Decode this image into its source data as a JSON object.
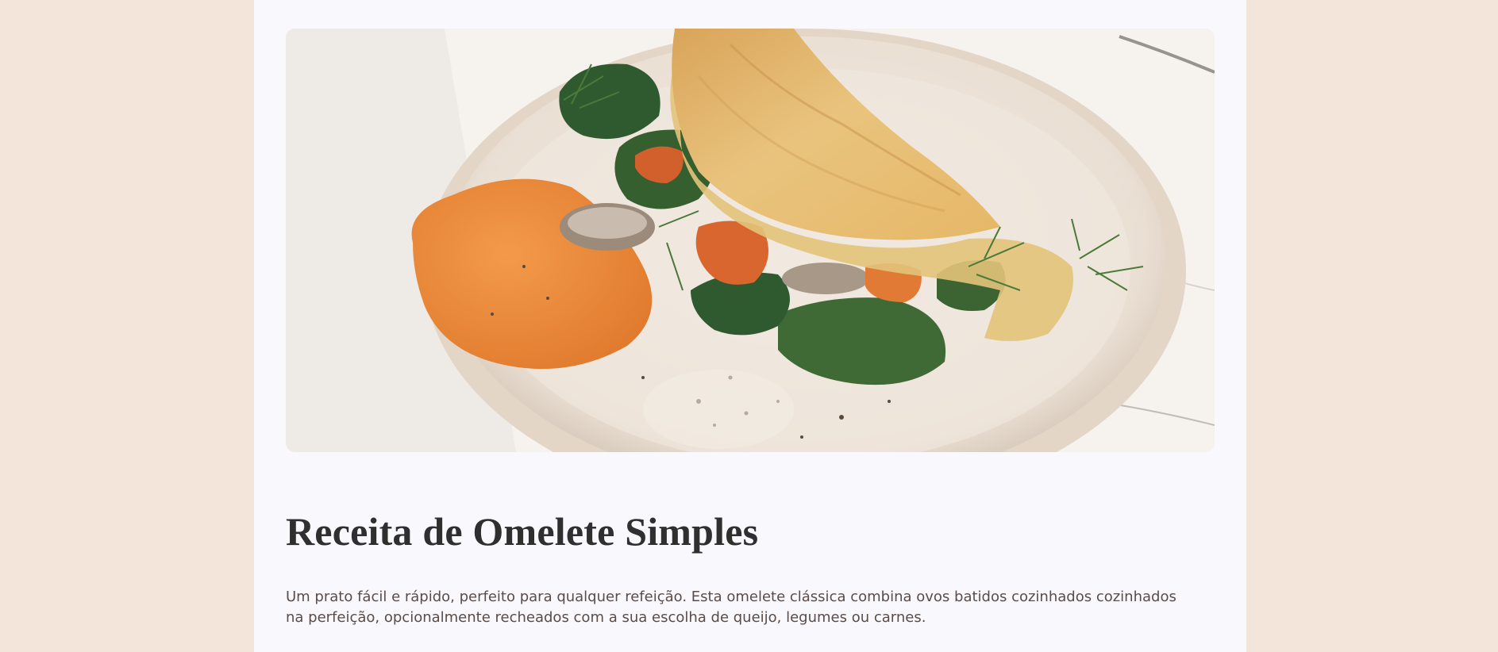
{
  "hero": {
    "image_alt": "Omelete dobrada servida num prato com espinafres, cogumelos e pasta de cenoura"
  },
  "recipe": {
    "title": "Receita de Omelete Simples",
    "description": "Um prato fácil e rápido, perfeito para qualquer refeição. Esta omelete clássica combina ovos batidos cozinhados cozinhados na perfeição, opcionalmente recheados com a sua escolha de queijo, legumes ou carnes."
  },
  "colors": {
    "page_background": "#f3e5da",
    "card_background": "#f9f8fd",
    "title": "#2f2f2f",
    "text": "#5a4d48"
  }
}
